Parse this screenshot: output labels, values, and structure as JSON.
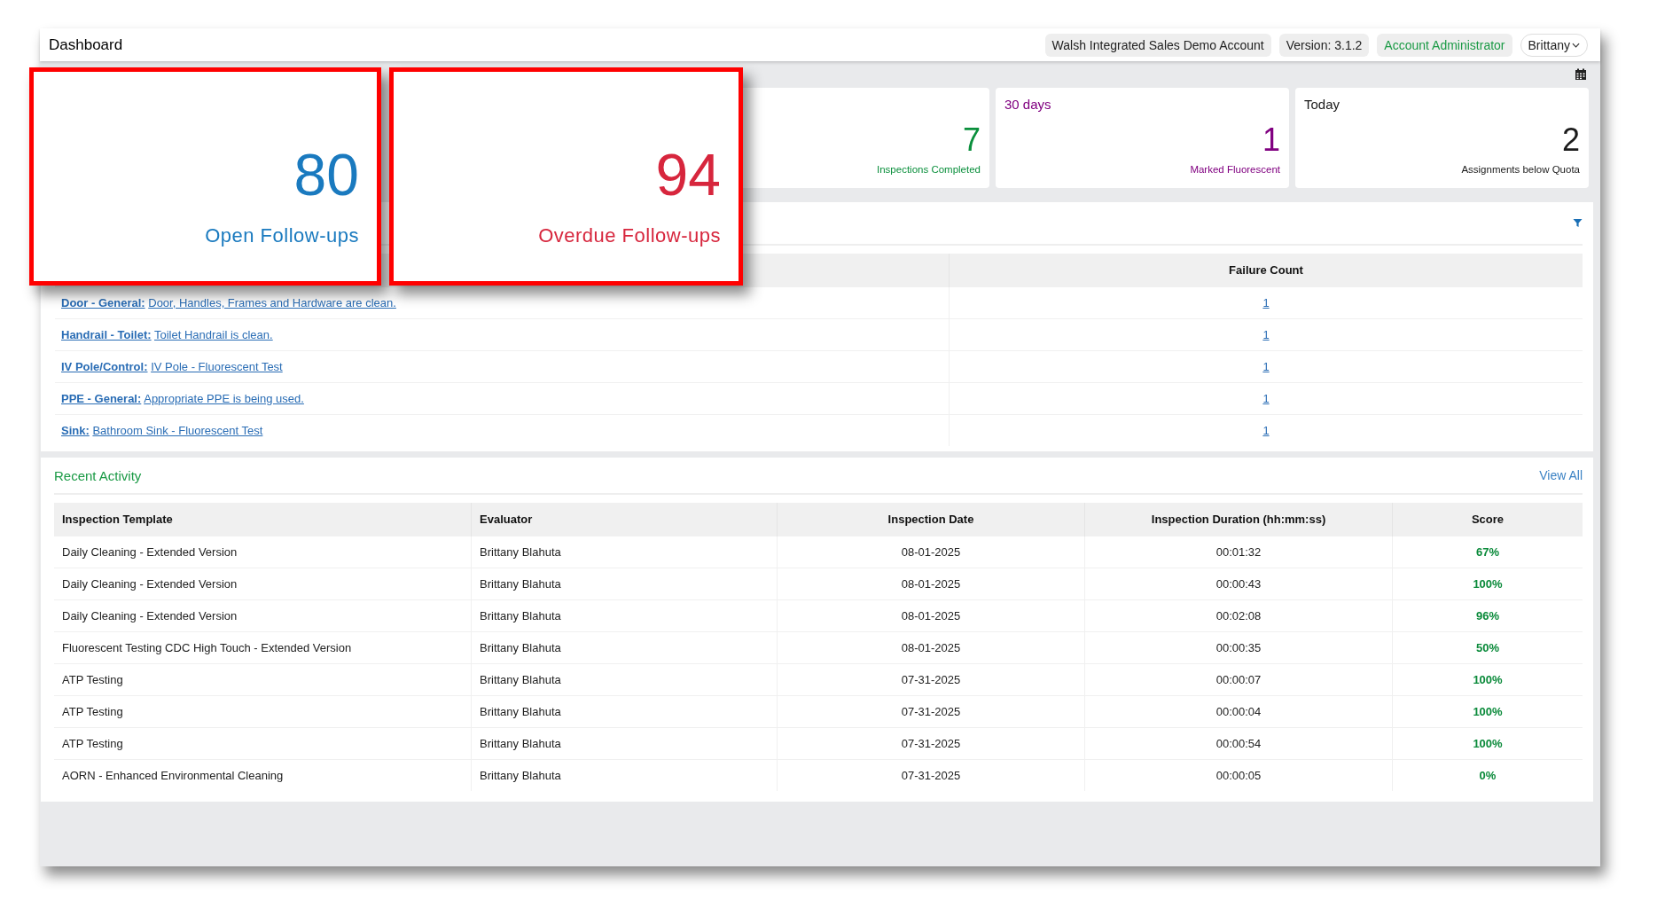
{
  "header": {
    "title": "Dashboard",
    "account": "Walsh Integrated Sales Demo Account",
    "version": "Version: 3.1.2",
    "role": "Account Administrator",
    "user": "Brittany"
  },
  "stat_cards": [
    {
      "value": "7",
      "label": "Inspections Completed",
      "color": "#0a8f3c"
    },
    {
      "period": "30 days",
      "value": "1",
      "label": "Marked Fluorescent",
      "color": "#800080"
    },
    {
      "period": "Today",
      "value": "2",
      "label": "Assignments below Quota",
      "color": "#1a1a1a"
    }
  ],
  "failures": {
    "columns": [
      "Failure Count"
    ],
    "rows": [
      {
        "category": "Door - General:",
        "description": "Door, Handles, Frames and Hardware are clean.",
        "count": "1"
      },
      {
        "category": "Handrail - Toilet:",
        "description": "Toilet Handrail is clean.",
        "count": "1"
      },
      {
        "category": "IV Pole/Control:",
        "description": "IV Pole - Fluorescent Test",
        "count": "1"
      },
      {
        "category": "PPE - General:",
        "description": "Appropriate PPE is being used.",
        "count": "1"
      },
      {
        "category": "Sink:",
        "description": "Bathroom Sink - Fluorescent Test",
        "count": "1"
      }
    ]
  },
  "recent_activity": {
    "title": "Recent Activity",
    "view_all": "View All",
    "columns": [
      "Inspection Template",
      "Evaluator",
      "Inspection Date",
      "Inspection Duration (hh:mm:ss)",
      "Score"
    ],
    "rows": [
      [
        "Daily Cleaning - Extended Version",
        "Brittany Blahuta",
        "08-01-2025",
        "00:01:32",
        "67%"
      ],
      [
        "Daily Cleaning - Extended Version",
        "Brittany Blahuta",
        "08-01-2025",
        "00:00:43",
        "100%"
      ],
      [
        "Daily Cleaning - Extended Version",
        "Brittany Blahuta",
        "08-01-2025",
        "00:02:08",
        "96%"
      ],
      [
        "Fluorescent Testing CDC High Touch - Extended Version",
        "Brittany Blahuta",
        "08-01-2025",
        "00:00:35",
        "50%"
      ],
      [
        "ATP Testing",
        "Brittany Blahuta",
        "07-31-2025",
        "00:00:07",
        "100%"
      ],
      [
        "ATP Testing",
        "Brittany Blahuta",
        "07-31-2025",
        "00:00:04",
        "100%"
      ],
      [
        "ATP Testing",
        "Brittany Blahuta",
        "07-31-2025",
        "00:00:54",
        "100%"
      ],
      [
        "AORN - Enhanced Environmental Cleaning",
        "Brittany Blahuta",
        "07-31-2025",
        "00:00:05",
        "0%"
      ]
    ]
  },
  "callouts": [
    {
      "value": "80",
      "label": "Open Follow-ups",
      "color": "#1a7abf"
    },
    {
      "value": "94",
      "label": "Overdue Follow-ups",
      "color": "#d7263d"
    }
  ]
}
